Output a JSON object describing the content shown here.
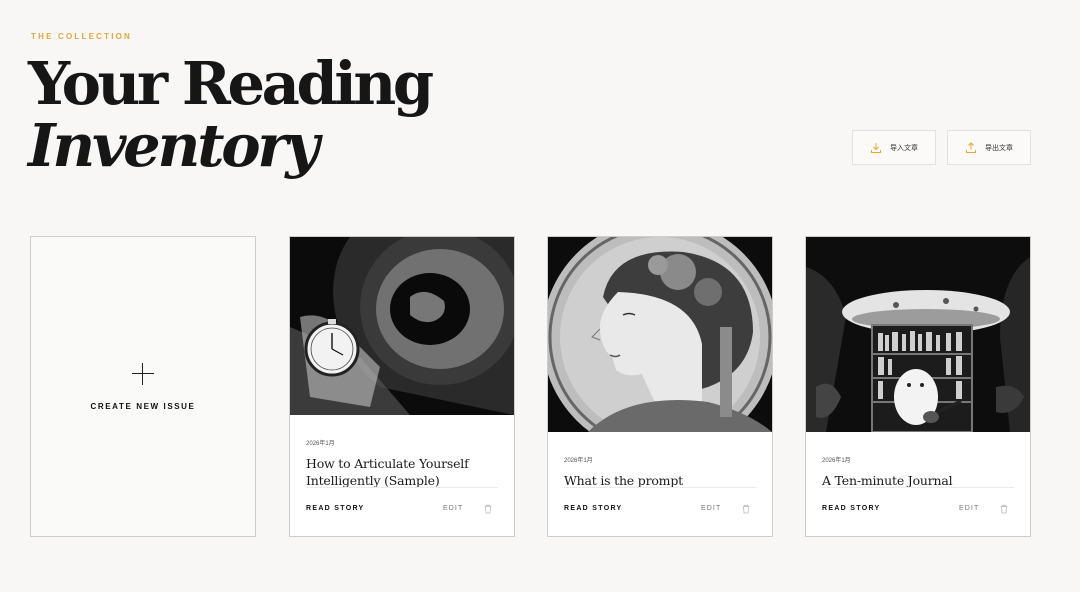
{
  "header": {
    "eyebrow": "THE COLLECTION",
    "title_line1": "Your Reading",
    "title_line2": "Inventory"
  },
  "actions": {
    "import_label": "导入文章",
    "export_label": "导出文章",
    "import_icon": "download-icon",
    "export_icon": "upload-icon",
    "accent_color": "#e0a93a"
  },
  "create": {
    "label": "CREATE NEW ISSUE",
    "icon": "plus-icon"
  },
  "stories": [
    {
      "date": "2026年1月",
      "title": "How to Articulate Yourself Intelligently (Sample)",
      "read_label": "READ STORY",
      "edit_label": "EDIT",
      "cover": "astronaut-pocket-watch-illustration"
    },
    {
      "date": "2026年1月",
      "title": "What is the prompt",
      "read_label": "READ STORY",
      "edit_label": "EDIT",
      "cover": "art-nouveau-woman-portrait"
    },
    {
      "date": "2026年1月",
      "title": "A Ten-minute Journal",
      "read_label": "READ STORY",
      "edit_label": "EDIT",
      "cover": "mushroom-library-illustration"
    }
  ]
}
